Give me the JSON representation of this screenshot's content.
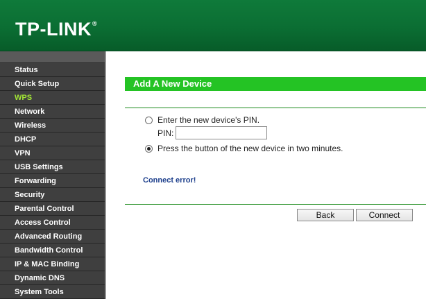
{
  "header": {
    "logo": "TP-LINK",
    "logo_mark": "®"
  },
  "sidebar": {
    "items": [
      {
        "label": "Status"
      },
      {
        "label": "Quick Setup"
      },
      {
        "label": "WPS"
      },
      {
        "label": "Network"
      },
      {
        "label": "Wireless"
      },
      {
        "label": "DHCP"
      },
      {
        "label": "VPN"
      },
      {
        "label": "USB Settings"
      },
      {
        "label": "Forwarding"
      },
      {
        "label": "Security"
      },
      {
        "label": "Parental Control"
      },
      {
        "label": "Access Control"
      },
      {
        "label": "Advanced Routing"
      },
      {
        "label": "Bandwidth Control"
      },
      {
        "label": "IP & MAC Binding"
      },
      {
        "label": "Dynamic DNS"
      },
      {
        "label": "System Tools"
      }
    ],
    "active_index": 2
  },
  "main": {
    "title": "Add A New Device",
    "option_pin": "Enter the new device's PIN.",
    "pin_label": "PIN:",
    "pin_value": "",
    "option_button": "Press the button of the new device in two minutes.",
    "selected_option": "button",
    "error": "Connect error!",
    "back_label": "Back",
    "connect_label": "Connect"
  },
  "colors": {
    "header_green": "#0b6e33",
    "title_bar_green": "#24c324",
    "active_nav": "#a3e635",
    "error_blue": "#1d3f8c"
  }
}
